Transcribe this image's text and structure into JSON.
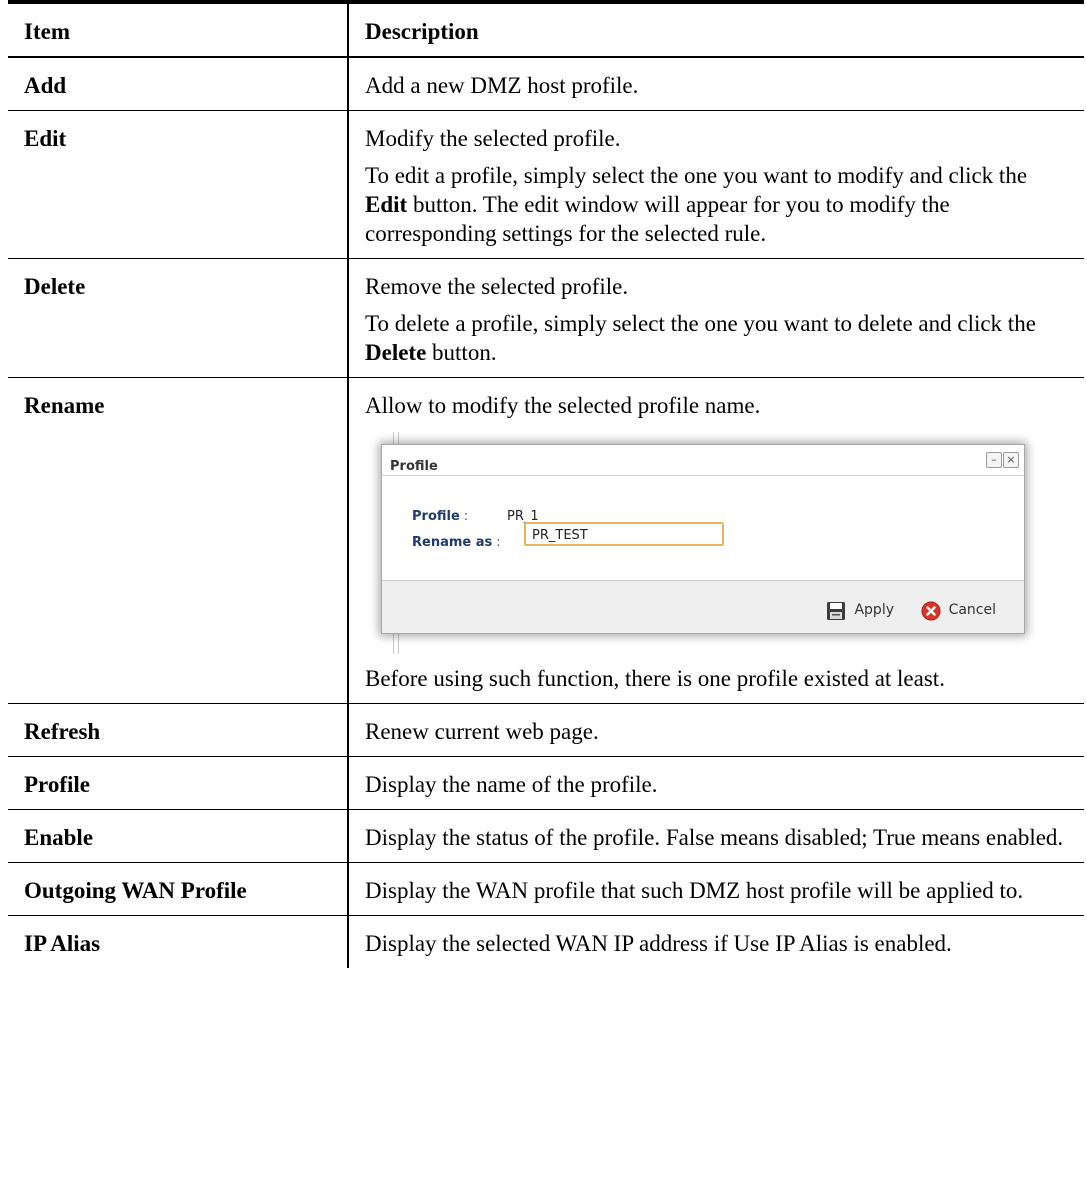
{
  "table": {
    "header": {
      "item": "Item",
      "description": "Description"
    },
    "rows": [
      {
        "item": "Add",
        "desc": [
          "Add a new DMZ host profile."
        ]
      },
      {
        "item": "Edit",
        "desc": [
          "Modify the selected profile."
        ]
      },
      {
        "item": "Delete",
        "desc": [
          "Remove the selected profile."
        ]
      },
      {
        "item": "Rename",
        "desc": [
          "Allow to modify the selected profile name.",
          "Before using such function, there is one profile existed at least."
        ]
      },
      {
        "item": "Refresh",
        "desc": [
          "Renew current web page."
        ]
      },
      {
        "item": "Profile",
        "desc": [
          "Display the name of the profile."
        ]
      },
      {
        "item": "Enable",
        "desc": [
          "Display the status of the profile. False means disabled; True means enabled."
        ]
      },
      {
        "item": "Outgoing WAN Profile",
        "desc": [
          "Display the WAN profile that such DMZ host profile will be applied to."
        ]
      },
      {
        "item": "IP Alias",
        "desc": [
          "Display the selected WAN IP address if Use IP Alias is enabled."
        ]
      }
    ],
    "edit_para": {
      "a": "To edit a profile, simply select the one you want to modify and click the ",
      "b": "Edit",
      "c": " button. The edit window will appear for you to modify the corresponding settings for the selected rule."
    },
    "delete_para": {
      "a": "To delete a profile, simply select the one you want to delete and click the ",
      "b": "Delete",
      "c": " button."
    }
  },
  "dialog": {
    "title": "Profile",
    "minimize_glyph": "–",
    "close_glyph": "×",
    "profile_label": "Profile",
    "profile_value": "PR_1",
    "rename_label": "Rename as",
    "rename_value": "PR_TEST",
    "colon": ":",
    "apply_label": "Apply",
    "cancel_label": "Cancel",
    "apply_icon": "save-icon",
    "cancel_icon": "cancel-icon"
  }
}
